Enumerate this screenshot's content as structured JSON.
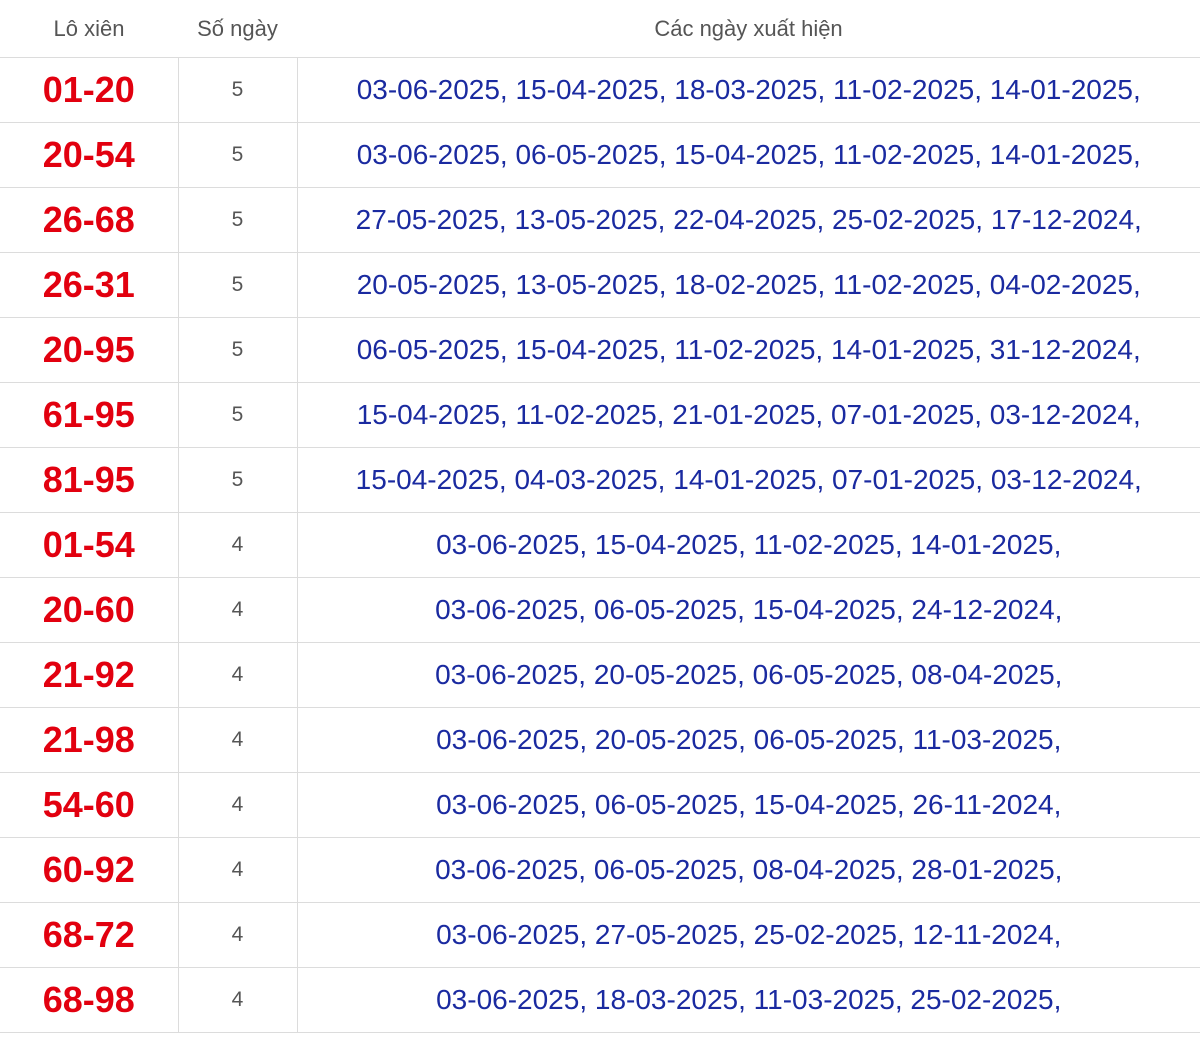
{
  "headers": {
    "pair": "Lô xiên",
    "count": "Số ngày",
    "dates": "Các ngày xuất hiện"
  },
  "rows": [
    {
      "pair": "01-20",
      "count": "5",
      "dates": "03-06-2025, 15-04-2025, 18-03-2025, 11-02-2025, 14-01-2025,"
    },
    {
      "pair": "20-54",
      "count": "5",
      "dates": "03-06-2025, 06-05-2025, 15-04-2025, 11-02-2025, 14-01-2025,"
    },
    {
      "pair": "26-68",
      "count": "5",
      "dates": "27-05-2025, 13-05-2025, 22-04-2025, 25-02-2025, 17-12-2024,"
    },
    {
      "pair": "26-31",
      "count": "5",
      "dates": "20-05-2025, 13-05-2025, 18-02-2025, 11-02-2025, 04-02-2025,"
    },
    {
      "pair": "20-95",
      "count": "5",
      "dates": "06-05-2025, 15-04-2025, 11-02-2025, 14-01-2025, 31-12-2024,"
    },
    {
      "pair": "61-95",
      "count": "5",
      "dates": "15-04-2025, 11-02-2025, 21-01-2025, 07-01-2025, 03-12-2024,"
    },
    {
      "pair": "81-95",
      "count": "5",
      "dates": "15-04-2025, 04-03-2025, 14-01-2025, 07-01-2025, 03-12-2024,"
    },
    {
      "pair": "01-54",
      "count": "4",
      "dates": "03-06-2025, 15-04-2025, 11-02-2025, 14-01-2025,"
    },
    {
      "pair": "20-60",
      "count": "4",
      "dates": "03-06-2025, 06-05-2025, 15-04-2025, 24-12-2024,"
    },
    {
      "pair": "21-92",
      "count": "4",
      "dates": "03-06-2025, 20-05-2025, 06-05-2025, 08-04-2025,"
    },
    {
      "pair": "21-98",
      "count": "4",
      "dates": "03-06-2025, 20-05-2025, 06-05-2025, 11-03-2025,"
    },
    {
      "pair": "54-60",
      "count": "4",
      "dates": "03-06-2025, 06-05-2025, 15-04-2025, 26-11-2024,"
    },
    {
      "pair": "60-92",
      "count": "4",
      "dates": "03-06-2025, 06-05-2025, 08-04-2025, 28-01-2025,"
    },
    {
      "pair": "68-72",
      "count": "4",
      "dates": "03-06-2025, 27-05-2025, 25-02-2025, 12-11-2024,"
    },
    {
      "pair": "68-98",
      "count": "4",
      "dates": "03-06-2025, 18-03-2025, 11-03-2025, 25-02-2025,"
    }
  ]
}
